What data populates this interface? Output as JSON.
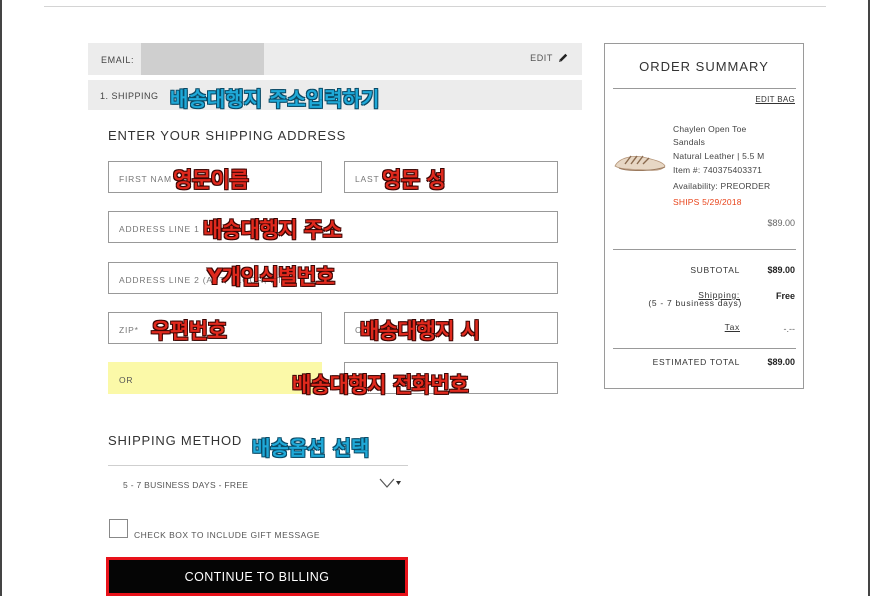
{
  "email_row": {
    "label": "EMAIL:",
    "edit_label": "EDIT"
  },
  "shipping_row": {
    "label": "1. SHIPPING",
    "annotation": "배송대행지 주소입력하기"
  },
  "address_heading": "ENTER YOUR SHIPPING ADDRESS",
  "fields": {
    "first_name": {
      "placeholder": "FIRST NAM",
      "annotation": "영문이름"
    },
    "last_name": {
      "placeholder": "LAST",
      "annotation": "영문 성"
    },
    "address1": {
      "placeholder": "ADDRESS LINE 1",
      "annotation": "배송대행지 주소"
    },
    "address2": {
      "placeholder": "ADDRESS LINE 2 (APT, FLOOR, ETC.)",
      "annotation": "Y개인식별번호"
    },
    "zip": {
      "placeholder": "ZIP*",
      "annotation": "우편번호"
    },
    "city": {
      "placeholder": "C",
      "annotation": "배송대행지 시"
    },
    "phone_left": {
      "placeholder": "OR"
    },
    "phone": {
      "annotation": "배송대행지 전화번호"
    }
  },
  "shipping_method": {
    "heading": "SHIPPING METHOD",
    "annotation": "배송옵션 선택",
    "selected": "5 - 7 BUSINESS DAYS - FREE"
  },
  "gift_message_label": "CHECK BOX TO INCLUDE GIFT MESSAGE",
  "continue_button": "CONTINUE TO BILLING",
  "order_summary": {
    "title": "ORDER SUMMARY",
    "edit_bag": "EDIT BAG",
    "product": {
      "name_line1": "Chaylen Open Toe",
      "name_line2": "Sandals",
      "variant": "Natural Leather | 5.5 M",
      "item": "Item #: 740375403371",
      "availability": "Availability: PREORDER",
      "ships": "SHIPS 5/29/2018",
      "price": "$89.00"
    },
    "subtotal_label": "SUBTOTAL",
    "subtotal_value": "$89.00",
    "shipping_label": "Shipping:",
    "shipping_sub": "(5 - 7 business days)",
    "shipping_value": "Free",
    "tax_label": "Tax",
    "tax_value": "-.--",
    "estimated_label": "ESTIMATED TOTAL",
    "estimated_value": "$89.00"
  },
  "colors": {
    "accent_red": "#e8121a",
    "annotation_blue": "#1fa9d8",
    "annotation_red": "#e0291d",
    "highlight_yellow": "#fbf9a8"
  }
}
